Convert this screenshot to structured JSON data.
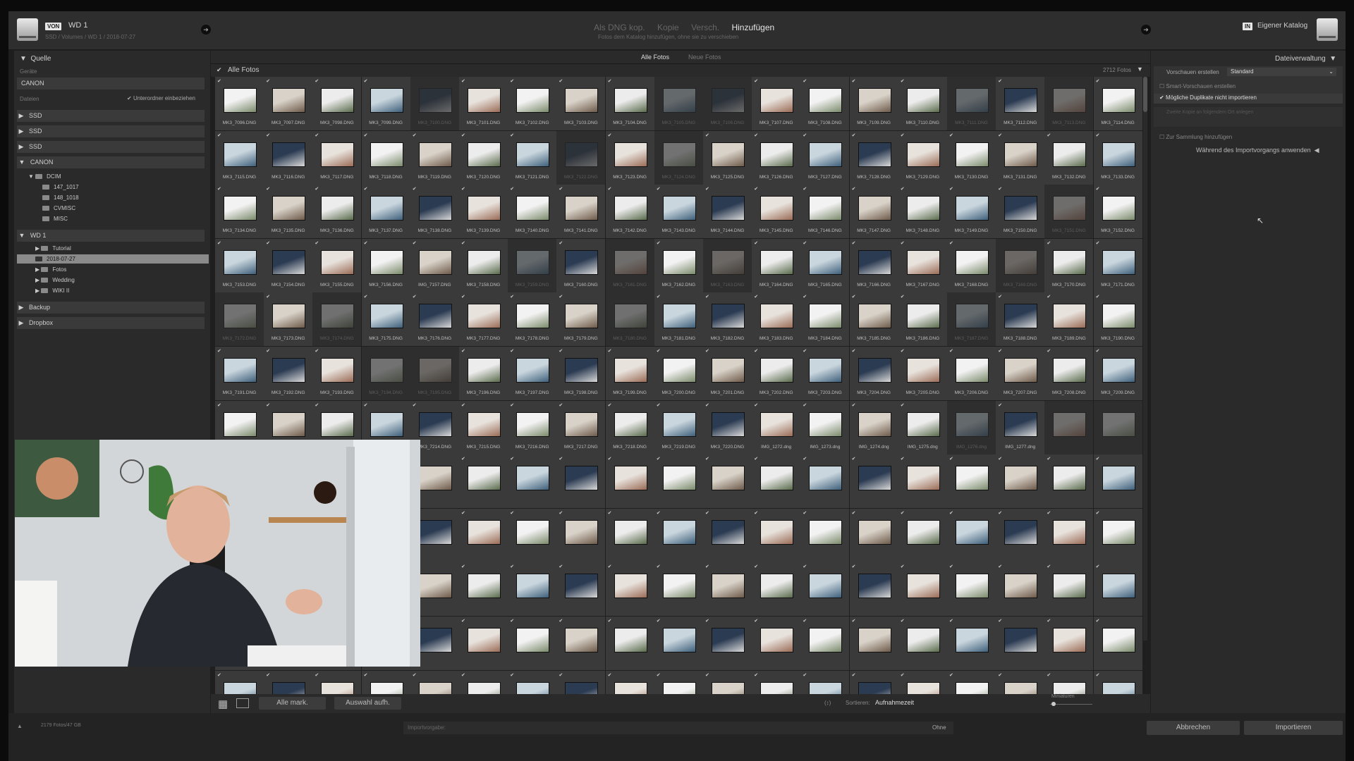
{
  "topbar": {
    "from_badge": "VON",
    "source_title": "WD 1",
    "source_path": "SSD / Volumes / WD 1 / 2018-07-27",
    "modes": [
      "Als DNG kop.",
      "Kopie",
      "Versch.",
      "Hinzufügen"
    ],
    "modes_subtitle": "Fotos dem Katalog hinzufügen, ohne sie zu verschieben",
    "to_badge": "IN",
    "catalog_label": "Eigener Katalog"
  },
  "left": {
    "header": "Quelle",
    "devices_label": "Geräte",
    "device_name": "CANON",
    "files_label": "Dateien",
    "include_subfolders": "Unterordner einbeziehen",
    "drives": [
      "SSD",
      "SSD",
      "SSD"
    ],
    "canon_drive": "CANON",
    "canon_folders": [
      "DCIM",
      "147_1017",
      "148_1018",
      "CVMISC",
      "MISC"
    ],
    "wd_drive": "WD 1",
    "wd_folders": [
      "Tutorial",
      "2018-07-27",
      "Fotos",
      "Wedding",
      "WIKI II"
    ],
    "backup": "Backup",
    "dropbox": "Dropbox"
  },
  "center": {
    "tabs": [
      "Alle Fotos",
      "Neue Fotos"
    ],
    "all_photos_label": "Alle Fotos",
    "count": "2712 Fotos"
  },
  "right": {
    "header": "Dateiverwaltung",
    "preview_label": "Vorschauen erstellen",
    "preview_value": "Standard",
    "smart_preview": "Smart-Vorschauen erstellen",
    "no_duplicates": "Mögliche Duplikate nicht importieren",
    "second_copy": "Zweite Kopie an folgendem Ort anlegen",
    "add_collection": "Zur Sammlung hinzufügen",
    "apply_during": "Während des Importvorgangs anwenden"
  },
  "bottom": {
    "select_all": "Alle mark.",
    "deselect_all": "Auswahl aufh.",
    "sort_label": "Sortieren:",
    "sort_value": "Aufnahmezeit",
    "thumb_label": "Miniaturen",
    "status": "2179 Fotos/47 GB",
    "preset_label": "Importvorgabe:",
    "preset_value": "Ohne",
    "cancel": "Abbrechen",
    "import": "Importieren"
  },
  "photos": [
    "MK3_7096.DNG",
    "MK3_7097.DNG",
    "MK3_7098.DNG",
    "MK3_7099.DNG",
    "MK3_7100.DNG",
    "MK3_7101.DNG",
    "MK3_7102.DNG",
    "MK3_7103.DNG",
    "MK3_7104.DNG",
    "MK3_7105.DNG",
    "MK3_7106.DNG",
    "MK3_7107.DNG",
    "MK3_7108.DNG",
    "MK3_7109.DNG",
    "MK3_7110.DNG",
    "MK3_7111.DNG",
    "MK3_7112.DNG",
    "MK3_7113.DNG",
    "MK3_7114.DNG",
    "MK3_7115.DNG",
    "MK3_7116.DNG",
    "MK3_7117.DNG",
    "MK3_7118.DNG",
    "MK3_7119.DNG",
    "MK3_7120.DNG",
    "MK3_7121.DNG",
    "MK3_7122.DNG",
    "MK3_7123.DNG",
    "MK3_7124.DNG",
    "MK3_7125.DNG",
    "MK3_7126.DNG",
    "MK3_7127.DNG",
    "MK3_7128.DNG",
    "MK3_7129.DNG",
    "MK3_7130.DNG",
    "MK3_7131.DNG",
    "MK3_7132.DNG",
    "MK3_7133.DNG",
    "MK3_7134.DNG",
    "MK3_7135.DNG",
    "MK3_7136.DNG",
    "MK3_7137.DNG",
    "MK3_7138.DNG",
    "MK3_7139.DNG",
    "MK3_7140.DNG",
    "MK3_7141.DNG",
    "MK3_7142.DNG",
    "MK3_7143.DNG",
    "MK3_7144.DNG",
    "MK3_7145.DNG",
    "MK3_7146.DNG",
    "MK3_7147.DNG",
    "MK3_7148.DNG",
    "MK3_7149.DNG",
    "MK3_7150.DNG",
    "MK3_7151.DNG",
    "MK3_7152.DNG",
    "MK3_7153.DNG",
    "MK3_7154.DNG",
    "MK3_7155.DNG",
    "MK3_7156.DNG",
    "IMG_7157.DNG",
    "MK3_7158.DNG",
    "MK3_7159.DNG",
    "MK3_7160.DNG",
    "MK3_7161.DNG",
    "MK3_7162.DNG",
    "MK3_7163.DNG",
    "MK3_7164.DNG",
    "MK3_7165.DNG",
    "MK3_7166.DNG",
    "MK3_7167.DNG",
    "MK3_7168.DNG",
    "MK3_7169.DNG",
    "MK3_7170.DNG",
    "MK3_7171.DNG",
    "MK3_7172.DNG",
    "MK3_7173.DNG",
    "MK3_7174.DNG",
    "MK3_7175.DNG",
    "MK3_7176.DNG",
    "MK3_7177.DNG",
    "MK3_7178.DNG",
    "MK3_7179.DNG",
    "MK3_7180.DNG",
    "MK3_7181.DNG",
    "MK3_7182.DNG",
    "MK3_7183.DNG",
    "MK3_7184.DNG",
    "MK3_7185.DNG",
    "MK3_7186.DNG",
    "MK3_7187.DNG",
    "MK3_7188.DNG",
    "MK3_7189.DNG",
    "MK3_7190.DNG",
    "MK3_7191.DNG",
    "MK3_7192.DNG",
    "MK3_7193.DNG",
    "MK3_7194.DNG",
    "MK3_7195.DNG",
    "MK3_7196.DNG",
    "MK3_7197.DNG",
    "MK3_7198.DNG",
    "MK3_7199.DNG",
    "MK3_7200.DNG",
    "MK3_7201.DNG",
    "MK3_7202.DNG",
    "MK3_7203.DNG",
    "MK3_7204.DNG",
    "MK3_7205.DNG",
    "MK3_7206.DNG",
    "MK3_7207.DNG",
    "MK3_7208.DNG",
    "MK3_7209.DNG",
    "MK3_7210.DNG",
    "MK3_7211.DNG",
    "MK3_7212.DNG",
    "MK3_7213.DNG",
    "MK3_7214.DNG",
    "MK3_7215.DNG",
    "MK3_7216.DNG",
    "MK3_7217.DNG",
    "MK3_7218.DNG",
    "MK3_7219.DNG",
    "MK3_7220.DNG",
    "IMG_1272.dng",
    "IMG_1273.dng",
    "IMG_1274.dng",
    "IMG_1275.dng",
    "IMG_1276.dng",
    "IMG_1277.dng",
    "",
    ""
  ],
  "dim_cells": [
    4,
    9,
    10,
    15,
    17,
    26,
    28,
    55,
    63,
    65,
    67,
    73,
    76,
    78,
    84,
    91,
    98,
    99,
    129,
    131,
    132,
    133
  ],
  "colors": {
    "accent": "#e6e6e6",
    "panel": "#2a2a2a",
    "cell": "#3a3a3a"
  }
}
